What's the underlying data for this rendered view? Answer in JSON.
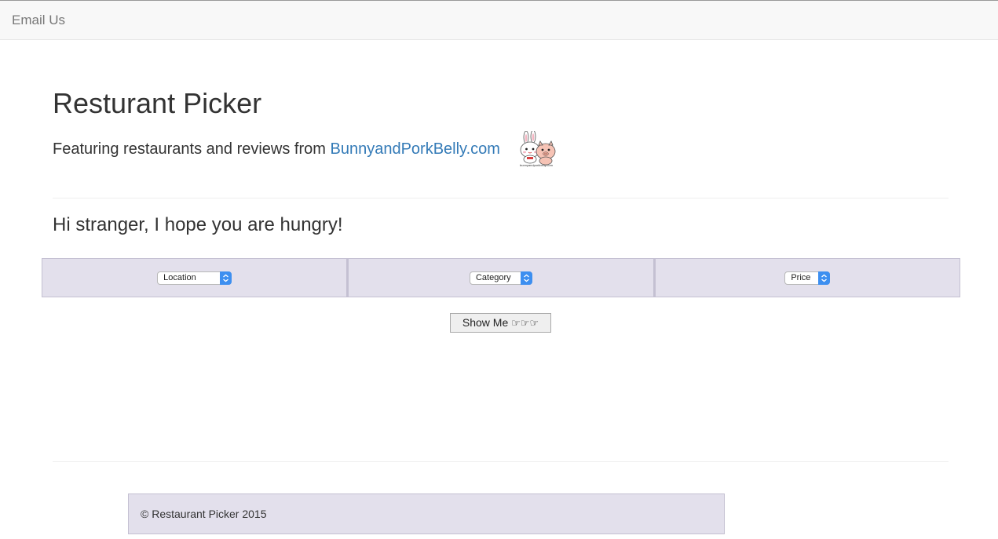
{
  "navbar": {
    "email_link": "Email Us"
  },
  "header": {
    "title": "Resturant Picker",
    "subtitle_prefix": "Featuring restaurants and reviews from ",
    "subtitle_link": "BunnyandPorkBelly.com",
    "logo_caption": "bunnyandporkbelly.com"
  },
  "greeting": "Hi stranger, I hope you are hungry!",
  "filters": {
    "location": "Location",
    "category": "Category",
    "price": "Price"
  },
  "show_button": {
    "label": "Show Me ",
    "pointers": "☞☞☞"
  },
  "footer": {
    "text": "© Restaurant Picker 2015"
  },
  "colors": {
    "link": "#337ab7",
    "panel": "#e3e0ec",
    "select_arrow": "#3d8ff0"
  }
}
